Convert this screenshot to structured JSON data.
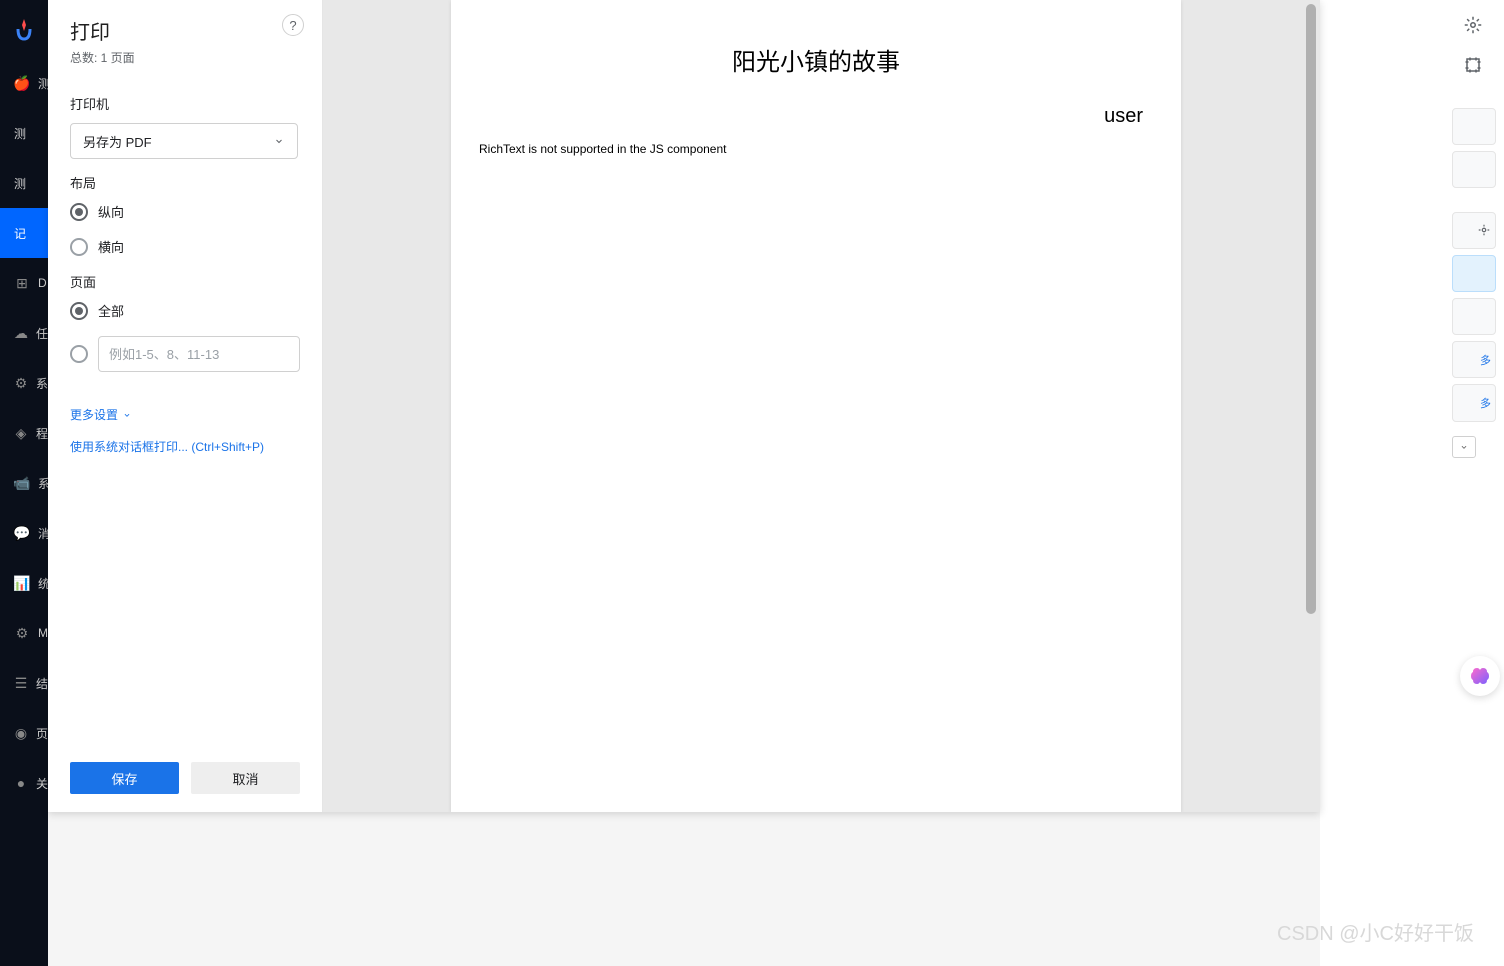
{
  "sidebar": {
    "items": [
      {
        "label": "测"
      },
      {
        "label": "测"
      },
      {
        "label": "测"
      },
      {
        "label": "记"
      },
      {
        "label": "D"
      },
      {
        "label": "任"
      },
      {
        "label": "系"
      },
      {
        "label": "程"
      },
      {
        "label": "系"
      },
      {
        "label": "消"
      },
      {
        "label": "统"
      },
      {
        "label": "M"
      },
      {
        "label": "结"
      },
      {
        "label": "页"
      },
      {
        "label": "关"
      }
    ]
  },
  "print": {
    "title": "打印",
    "page_count_label": "总数: 1 页面",
    "help_tooltip": "?",
    "printer_label": "打印机",
    "printer_value": "另存为 PDF",
    "layout_label": "布局",
    "layout_portrait": "纵向",
    "layout_landscape": "横向",
    "pages_label": "页面",
    "pages_all": "全部",
    "pages_range_placeholder": "例如1-5、8、11-13",
    "more_settings": "更多设置",
    "system_dialog": "使用系统对话框打印... (Ctrl+Shift+P)",
    "save_btn": "保存",
    "cancel_btn": "取消"
  },
  "document": {
    "title": "阳光小镇的故事",
    "author": "user",
    "body": "RichText is not supported in the JS component"
  },
  "right_panel": {
    "more1": "多",
    "more2": "多"
  },
  "watermark": "CSDN @小C好好干饭"
}
